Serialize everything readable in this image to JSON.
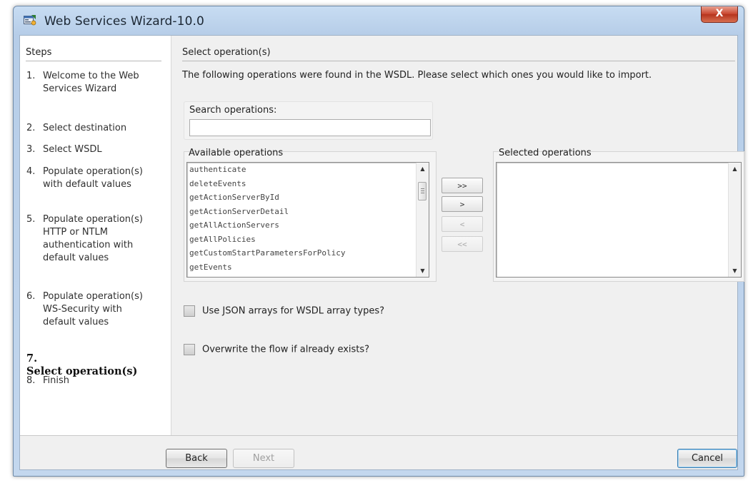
{
  "window": {
    "title": "Web Services Wizard-10.0",
    "close_label": "X"
  },
  "steps": {
    "header": "Steps",
    "items": [
      {
        "num": "1.",
        "label": "Welcome to the Web\nServices Wizard"
      },
      {
        "num": "2.",
        "label": "Select destination"
      },
      {
        "num": "3.",
        "label": "Select WSDL"
      },
      {
        "num": "4.",
        "label": "Populate operation(s)\nwith default values"
      },
      {
        "num": "5.",
        "label": "Populate operation(s)\nHTTP or NTLM\nauthentication with\ndefault values"
      },
      {
        "num": "6.",
        "label": "Populate operation(s)\nWS-Security with\ndefault values"
      },
      {
        "num": "7.",
        "label": "Select operation(s)"
      },
      {
        "num": "8.",
        "label": "Finish"
      }
    ]
  },
  "main": {
    "section_title": "Select operation(s)",
    "description": "The following operations were found in the WSDL. Please select which ones you would like to import.",
    "search": {
      "label": "Search operations:",
      "value": ""
    },
    "available": {
      "label": "Available operations",
      "items": [
        "authenticate",
        "deleteEvents",
        "getActionServerById",
        "getActionServerDetail",
        "getAllActionServers",
        "getAllPolicies",
        "getCustomStartParametersForPolicy",
        "getEvents"
      ],
      "scroll_position": 0.2
    },
    "selected": {
      "label": "Selected operations",
      "items": []
    },
    "move_buttons": {
      "add_all": ">>",
      "add": ">",
      "remove": "<",
      "remove_all": "<<"
    },
    "options": [
      {
        "label": "Use JSON arrays for WSDL array types?",
        "checked": false
      },
      {
        "label": "Overwrite the flow if already exists?",
        "checked": false
      }
    ]
  },
  "footer": {
    "back": "Back",
    "next": "Next",
    "cancel": "Cancel"
  }
}
